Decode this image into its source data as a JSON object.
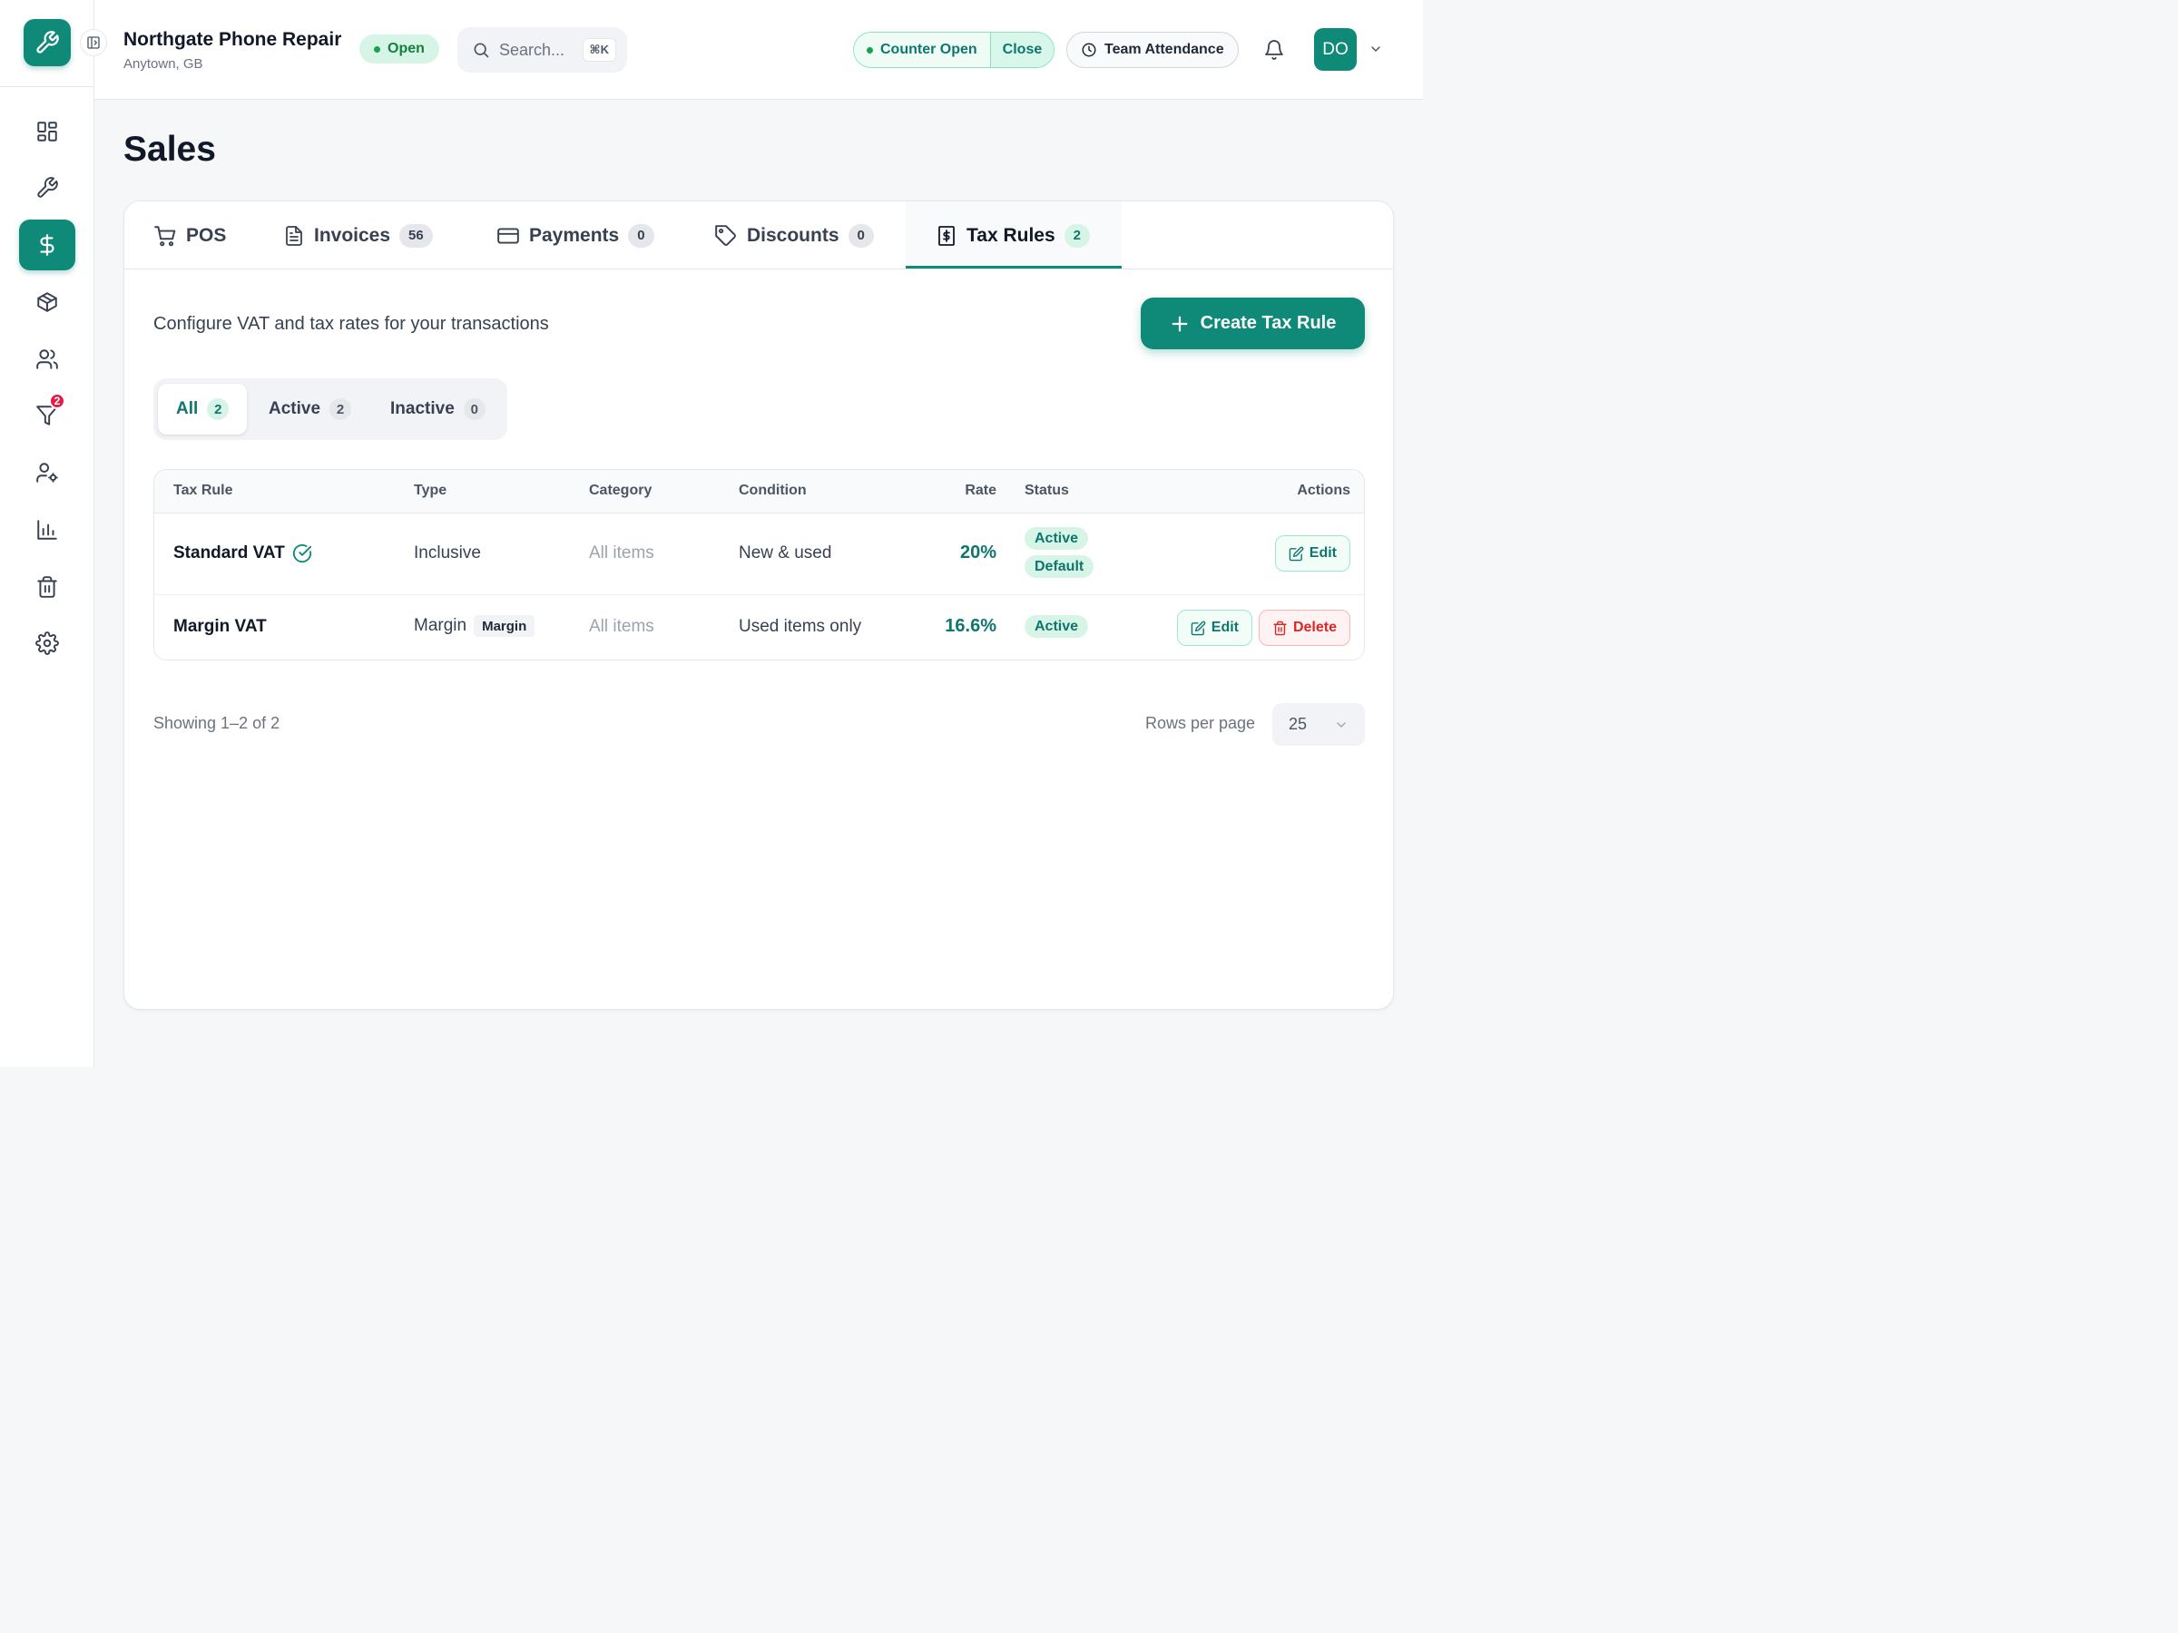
{
  "header": {
    "shop_name": "Northgate Phone Repair",
    "location": "Anytown, GB",
    "status": "Open",
    "search_placeholder": "Search...",
    "search_shortcut": "⌘K",
    "counter_status": "Counter Open",
    "counter_action": "Close",
    "attendance_label": "Team Attendance",
    "avatar_initials": "DO"
  },
  "sidebar": {
    "items": [
      {
        "icon": "dashboard-icon",
        "active": false
      },
      {
        "icon": "wrench-icon",
        "active": false
      },
      {
        "icon": "dollar-icon",
        "active": true
      },
      {
        "icon": "box-icon",
        "active": false
      },
      {
        "icon": "users-icon",
        "active": false
      },
      {
        "icon": "funnel-icon",
        "active": false,
        "badge": "2"
      },
      {
        "icon": "user-settings-icon",
        "active": false
      },
      {
        "icon": "bar-chart-icon",
        "active": false
      },
      {
        "icon": "trash-icon",
        "active": false
      },
      {
        "icon": "settings-icon",
        "active": false
      }
    ]
  },
  "page": {
    "title": "Sales"
  },
  "tabs": [
    {
      "label": "POS",
      "count": null,
      "icon": "cart-icon"
    },
    {
      "label": "Invoices",
      "count": "56",
      "icon": "document-icon"
    },
    {
      "label": "Payments",
      "count": "0",
      "icon": "credit-card-icon"
    },
    {
      "label": "Discounts",
      "count": "0",
      "icon": "tag-icon"
    },
    {
      "label": "Tax Rules",
      "count": "2",
      "icon": "receipt-icon",
      "active": true
    }
  ],
  "tax_rules": {
    "description": "Configure VAT and tax rates for your transactions",
    "create_button": "Create Tax Rule",
    "filters": [
      {
        "label": "All",
        "count": "2",
        "active": true
      },
      {
        "label": "Active",
        "count": "2"
      },
      {
        "label": "Inactive",
        "count": "0"
      }
    ],
    "columns": [
      "Tax Rule",
      "Type",
      "Category",
      "Condition",
      "Rate",
      "Status",
      "Actions"
    ],
    "rows": [
      {
        "name": "Standard VAT",
        "type": "Inclusive",
        "type_tag": "",
        "category": "All items",
        "condition": "New & used",
        "rate": "20%",
        "status": "Active",
        "status_extra": "Default",
        "edit": "Edit"
      },
      {
        "name": "Margin VAT",
        "type": "Margin",
        "type_tag": "Margin",
        "category": "All items",
        "condition": "Used items only",
        "rate": "16.6%",
        "status": "Active",
        "edit": "Edit",
        "delete": "Delete"
      }
    ],
    "showing": "Showing 1–2 of 2",
    "rows_per_page_label": "Rows per page",
    "rows_per_page_value": "25"
  },
  "colors": {
    "brand": "#0f8a78",
    "success_bg": "#d7f5e6",
    "danger": "#dc2626"
  }
}
